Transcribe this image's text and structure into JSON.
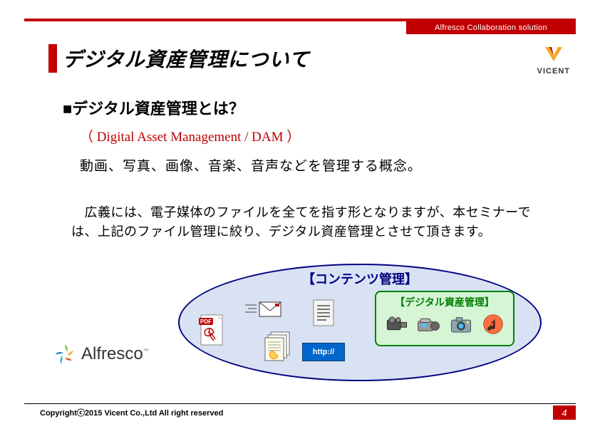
{
  "header": {
    "right_bar": "Alfresco Collaboration solution",
    "vicent": "VICENT"
  },
  "title": "デジタル資産管理について",
  "content": {
    "h1": "■デジタル資産管理とは？",
    "subtitle": "（ Digital Asset Management / DAM ）",
    "body1": "動画、写真、画像、音楽、音声などを管理する概念。",
    "body2": "　広義には、電子媒体のファイルを全てを指す形となりますが、本セミナーでは、上記のファイル管理に絞り、デジタル資産管理とさせて頂きます。"
  },
  "alfresco": "Alfresco",
  "diagram": {
    "outer_label": "【コンテンツ管理】",
    "inner_label": "【デジタル資産管理】",
    "http_label": "http://",
    "icons": {
      "pdf": "pdf-icon",
      "envelope": "envelope-icon",
      "text_doc": "text-doc-icon",
      "doc_stack": "doc-stack-icon",
      "camcorder1": "camcorder-icon",
      "camcorder2": "camcorder2-icon",
      "camera": "camera-icon",
      "music": "music-icon"
    }
  },
  "footer": {
    "copyright": "Copyrightⓒ2015 Vicent Co.,Ltd All right reserved",
    "page": "4"
  }
}
